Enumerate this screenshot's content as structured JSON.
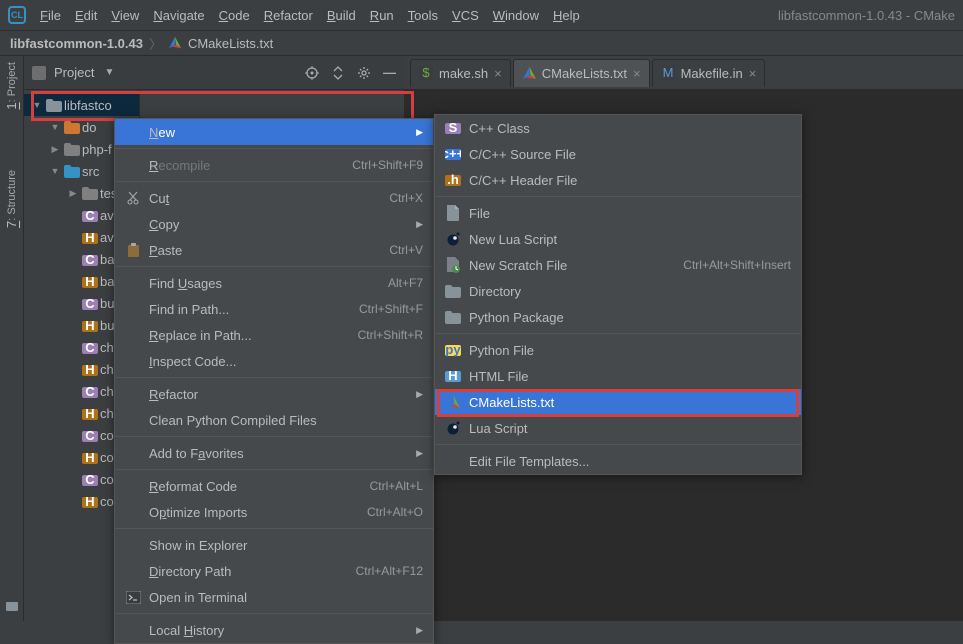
{
  "app": {
    "title_right": "libfastcommon-1.0.43 - CMake"
  },
  "menu": {
    "items": [
      "File",
      "Edit",
      "View",
      "Navigate",
      "Code",
      "Refactor",
      "Build",
      "Run",
      "Tools",
      "VCS",
      "Window",
      "Help"
    ]
  },
  "breadcrumb": {
    "project": "libfastcommon-1.0.43",
    "file": "CMakeLists.txt"
  },
  "toolstrip": {
    "project": "1: Project",
    "structure": "7: Structure"
  },
  "project_header": {
    "title": "Project"
  },
  "tree": {
    "root": "libfastco",
    "nodes": [
      {
        "indent": 1,
        "exp": "▼",
        "color": "#cc7832",
        "label": "do"
      },
      {
        "indent": 1,
        "exp": "▶",
        "color": "#808080",
        "label": "php-f"
      },
      {
        "indent": 1,
        "exp": "▼",
        "color": "#3592c4",
        "label": "src"
      },
      {
        "indent": 2,
        "exp": "▶",
        "color": "#808080",
        "label": "tes"
      },
      {
        "indent": 2,
        "exp": "",
        "type": "c",
        "label": "avl"
      },
      {
        "indent": 2,
        "exp": "",
        "type": "h",
        "label": "avl"
      },
      {
        "indent": 2,
        "exp": "",
        "type": "c",
        "label": "ba"
      },
      {
        "indent": 2,
        "exp": "",
        "type": "h",
        "label": "ba"
      },
      {
        "indent": 2,
        "exp": "",
        "type": "c",
        "label": "bu"
      },
      {
        "indent": 2,
        "exp": "",
        "type": "h",
        "label": "bu"
      },
      {
        "indent": 2,
        "exp": "",
        "type": "c",
        "label": "ch"
      },
      {
        "indent": 2,
        "exp": "",
        "type": "h",
        "label": "ch"
      },
      {
        "indent": 2,
        "exp": "",
        "type": "c",
        "label": "ch"
      },
      {
        "indent": 2,
        "exp": "",
        "type": "h",
        "label": "ch"
      },
      {
        "indent": 2,
        "exp": "",
        "type": "c",
        "label": "co"
      },
      {
        "indent": 2,
        "exp": "",
        "type": "h",
        "label": "co"
      },
      {
        "indent": 2,
        "exp": "",
        "type": "c",
        "label": "co"
      },
      {
        "indent": 2,
        "exp": "",
        "type": "h",
        "label": "co"
      }
    ]
  },
  "tabs": {
    "items": [
      {
        "label": "make.sh",
        "icon": "shell",
        "active": false
      },
      {
        "label": "CMakeLists.txt",
        "icon": "cmake",
        "active": true
      },
      {
        "label": "Makefile.in",
        "icon": "make",
        "active": false
      }
    ]
  },
  "ctx_main": {
    "items": [
      {
        "label": "New",
        "u": 0,
        "hi": true,
        "sub": true
      },
      {
        "sep": true
      },
      {
        "label": "Recompile",
        "u": 0,
        "shortcut": "Ctrl+Shift+F9",
        "dim": true
      },
      {
        "sep": true
      },
      {
        "label": "Cut",
        "u": 2,
        "icon": "cut",
        "shortcut": "Ctrl+X"
      },
      {
        "label": "Copy",
        "u": 0,
        "sub": true
      },
      {
        "label": "Paste",
        "u": 0,
        "icon": "paste",
        "shortcut": "Ctrl+V"
      },
      {
        "sep": true
      },
      {
        "label": "Find Usages",
        "u": 5,
        "shortcut": "Alt+F7"
      },
      {
        "label": "Find in Path...",
        "shortcut": "Ctrl+Shift+F"
      },
      {
        "label": "Replace in Path...",
        "u": 0,
        "shortcut": "Ctrl+Shift+R"
      },
      {
        "label": "Inspect Code...",
        "u": 0
      },
      {
        "sep": true
      },
      {
        "label": "Refactor",
        "u": 0,
        "sub": true
      },
      {
        "label": "Clean Python Compiled Files"
      },
      {
        "sep": true
      },
      {
        "label": "Add to Favorites",
        "u": 8,
        "sub": true
      },
      {
        "sep": true
      },
      {
        "label": "Reformat Code",
        "u": 0,
        "shortcut": "Ctrl+Alt+L"
      },
      {
        "label": "Optimize Imports",
        "u": 1,
        "shortcut": "Ctrl+Alt+O"
      },
      {
        "sep": true
      },
      {
        "label": "Show in Explorer"
      },
      {
        "label": "Directory Path",
        "u": 0,
        "shortcut": "Ctrl+Alt+F12"
      },
      {
        "label": "Open in Terminal",
        "icon": "terminal"
      },
      {
        "sep": true
      },
      {
        "label": "Local History",
        "u": 6,
        "sub": true
      }
    ]
  },
  "ctx_new": {
    "items": [
      {
        "label": "C++ Class",
        "icon": "cpp_class"
      },
      {
        "label": "C/C++ Source File",
        "icon": "cpp_src"
      },
      {
        "label": "C/C++ Header File",
        "icon": "cpp_hdr"
      },
      {
        "sep": true
      },
      {
        "label": "File",
        "icon": "file"
      },
      {
        "label": "New Lua Script",
        "icon": "lua"
      },
      {
        "label": "New Scratch File",
        "icon": "scratch",
        "shortcut": "Ctrl+Alt+Shift+Insert"
      },
      {
        "label": "Directory",
        "icon": "dir"
      },
      {
        "label": "Python Package",
        "icon": "pkg"
      },
      {
        "sep": true
      },
      {
        "label": "Python File",
        "icon": "py"
      },
      {
        "label": "HTML File",
        "icon": "html"
      },
      {
        "label": "CMakeLists.txt",
        "icon": "cmake",
        "hi": true
      },
      {
        "label": "Lua Script",
        "icon": "lua"
      },
      {
        "sep": true
      },
      {
        "label": "Edit File Templates..."
      }
    ]
  }
}
